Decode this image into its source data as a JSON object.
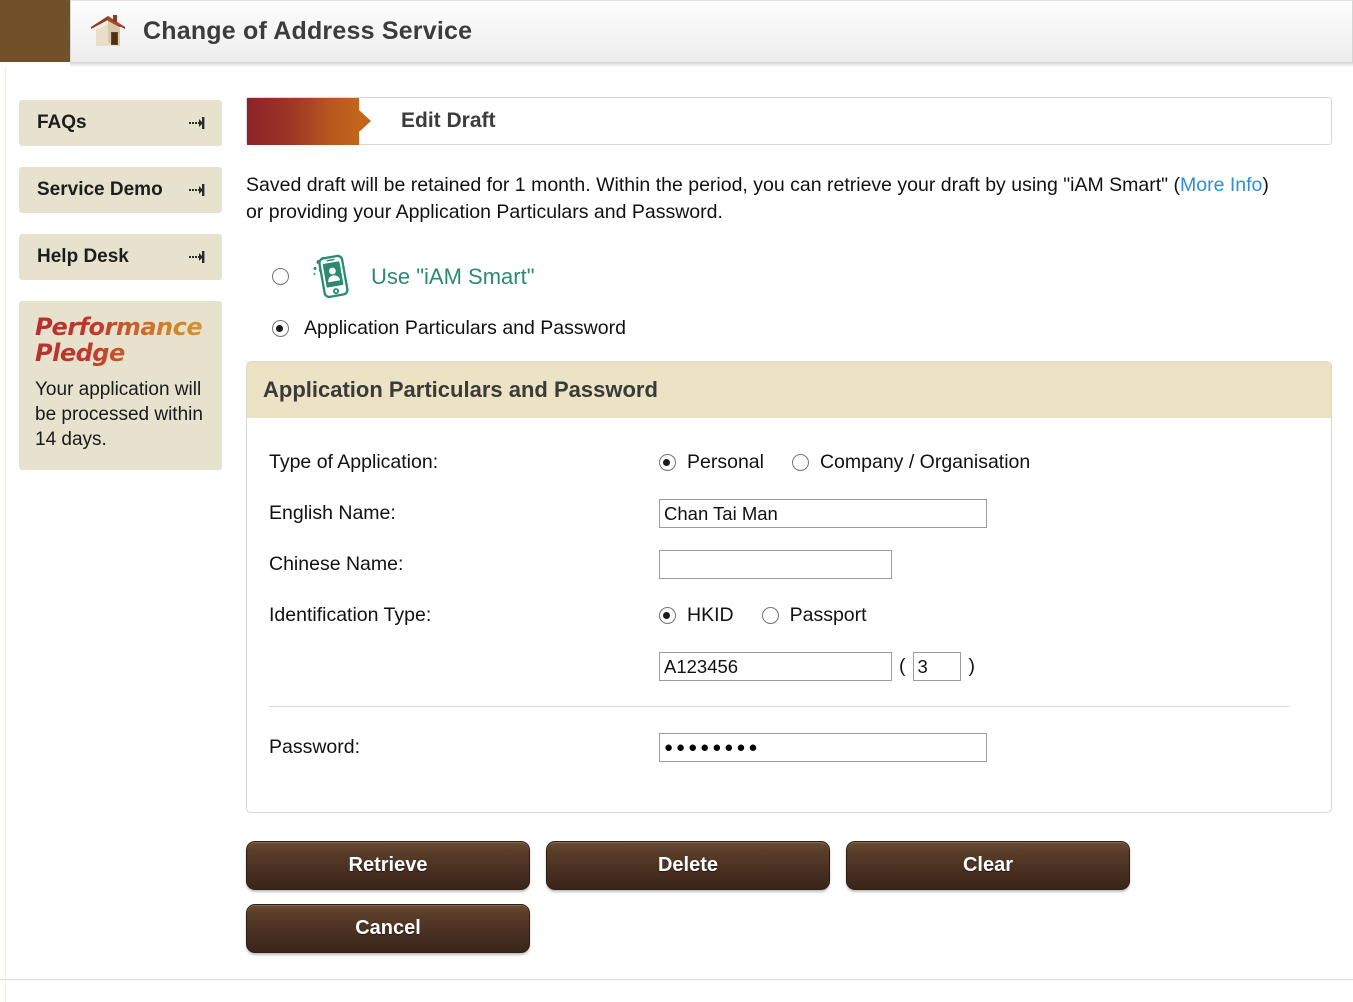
{
  "header": {
    "app_title": "Change of Address Service",
    "house_icon": "house-icon"
  },
  "sidebar": {
    "items": [
      {
        "label": "FAQs",
        "icon": "expand-arrow-icon"
      },
      {
        "label": "Service Demo",
        "icon": "expand-arrow-icon"
      },
      {
        "label": "Help Desk",
        "icon": "expand-arrow-icon"
      }
    ],
    "pledge": {
      "title_line1": "Performance",
      "title_line2": "Pledge",
      "text": "Your application will be processed within 14 days."
    }
  },
  "main": {
    "banner_title": "Edit Draft",
    "intro_part1": "Saved draft will be retained for 1 month. Within the period, you can retrieve your draft by using \"iAM Smart\" (",
    "intro_link": "More Info",
    "intro_part2": ") or providing your Application Particulars and Password.",
    "retrieval_options": [
      {
        "id": "iam-smart",
        "label": "Use \"iAM Smart\"",
        "checked": false,
        "icon": "iam-smart-phone-icon"
      },
      {
        "id": "app-particulars",
        "label": "Application Particulars and Password",
        "checked": true
      }
    ],
    "panel": {
      "title": "Application Particulars and Password",
      "fields": {
        "type_label": "Type of Application:",
        "type_options": [
          {
            "label": "Personal",
            "checked": true
          },
          {
            "label": "Company / Organisation",
            "checked": false
          }
        ],
        "english_name_label": "English Name:",
        "english_name_value": "Chan Tai Man",
        "english_name_placeholder": "",
        "chinese_name_label": "Chinese Name:",
        "chinese_name_value": "",
        "chinese_name_placeholder": "",
        "id_type_label": "Identification Type:",
        "id_type_options": [
          {
            "label": "HKID",
            "checked": true
          },
          {
            "label": "Passport",
            "checked": false
          }
        ],
        "id_number_value": "A123456",
        "id_number_placeholder": "",
        "id_check_value": "3",
        "id_check_placeholder": "",
        "paren_open": "(",
        "paren_close": ")",
        "password_label": "Password:",
        "password_value": "●●●●●●●●"
      }
    },
    "buttons": {
      "retrieve": "Retrieve",
      "delete": "Delete",
      "clear": "Clear",
      "cancel": "Cancel"
    }
  },
  "colors": {
    "brand_brown": "#70512a",
    "sidebar_beige": "#e7e2cd",
    "panel_head_beige": "#ebe3c3",
    "iam_teal": "#2c8a72",
    "link_blue": "#2d8fd5",
    "button_brown": "#4a3122",
    "banner_gradient_start": "#8e2328",
    "banner_gradient_end": "#c4651b"
  }
}
